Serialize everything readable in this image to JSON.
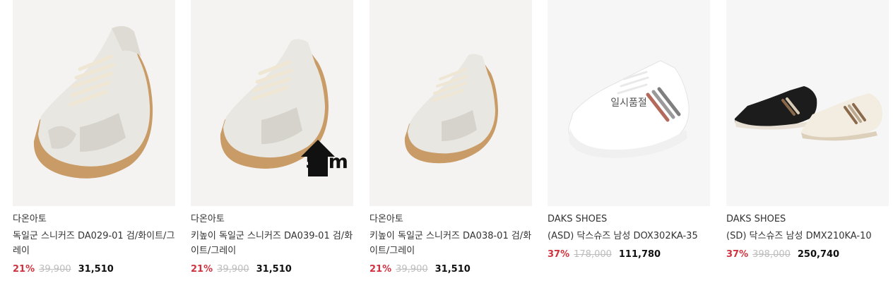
{
  "products": [
    {
      "brand": "다온아토",
      "name": "독일군 스니커즈 DA029-01 검/화이트/그레이",
      "discount": "21%",
      "original_price": "39,900",
      "sale_price": "31,510"
    },
    {
      "brand": "다온아토",
      "name": "키높이 독일군 스니커즈 DA039-01 검/화이트/그레이",
      "discount": "21%",
      "original_price": "39,900",
      "sale_price": "31,510",
      "badge": "5cm"
    },
    {
      "brand": "다온아토",
      "name": "키높이 독일군 스니커즈 DA038-01 검/화이트/그레이",
      "discount": "21%",
      "original_price": "39,900",
      "sale_price": "31,510"
    },
    {
      "brand": "DAKS SHOES",
      "name": "(ASD) 닥스슈즈 남성 DOX302KA-35",
      "discount": "37%",
      "original_price": "178,000",
      "sale_price": "111,780",
      "overlay": "일시품절"
    },
    {
      "brand": "DAKS SHOES",
      "name": "(SD) 닥스슈즈 남성 DMX210KA-10",
      "discount": "37%",
      "original_price": "398,000",
      "sale_price": "250,740"
    }
  ],
  "colors": {
    "discount": "#d0333f",
    "original_price": "#bdbdbd",
    "thumb_bg": "#f4f3f1"
  }
}
